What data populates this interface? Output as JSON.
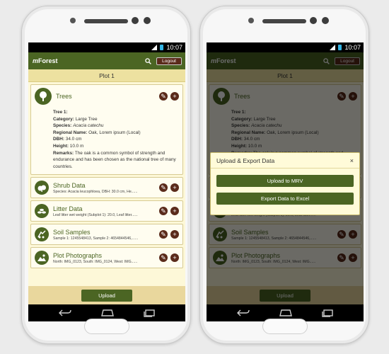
{
  "status": {
    "time": "10:07"
  },
  "app": {
    "brand_prefix": "m",
    "brand_name": "Forest",
    "logout_label": "Logout"
  },
  "plot": {
    "title": "Plot 1"
  },
  "trees": {
    "title": "Trees",
    "tree_heading": "Tree 1:",
    "fields": [
      {
        "label": "Category:",
        "value": "Large Tree"
      },
      {
        "label": "Species:",
        "value": "Acacia catechu"
      },
      {
        "label": "Regional Name:",
        "value": "Oak, Lorem ipsum (Local)"
      },
      {
        "label": "DBH:",
        "value": "34.0 cm"
      },
      {
        "label": "Height:",
        "value": "10.0 m"
      },
      {
        "label": "Remarks:",
        "value": "The oak is a common symbol of strength and endurance and has been chosen as the national tree of many countries."
      }
    ]
  },
  "sections": [
    {
      "title": "Shrub Data",
      "subtitle": "Species: Acacia leucophloea, DBH: 30.0 cm, He......"
    },
    {
      "title": "Litter Data",
      "subtitle": "Leaf litter wet weight (Subplot 1): 20.0, Leaf litter......"
    },
    {
      "title": "Soil Samples",
      "subtitle": "Sample 1: 1245548413, Sample 2: 4654844546,......"
    },
    {
      "title": "Plot Photographs",
      "subtitle": "North: IMG_0123, South: IMG_0124, West: IMG......"
    }
  ],
  "upload_label": "Upload",
  "dialog": {
    "title": "Upload & Export Data",
    "close_label": "×",
    "upload_mrv_label": "Upload to MRV",
    "export_excel_label": "Export Data to Excel"
  },
  "colors": {
    "brand_green": "#4b6523",
    "action_brown": "#5a2a1a",
    "background_cream": "#fdf8d8"
  },
  "icons": {
    "app": [
      "search-icon"
    ],
    "sections": [
      "tree-icon",
      "shrub-icon",
      "litter-icon",
      "soil-icon",
      "photo-icon"
    ],
    "actions": [
      "edit-icon",
      "add-icon"
    ],
    "nav": [
      "back-icon",
      "home-icon",
      "recents-icon"
    ]
  }
}
